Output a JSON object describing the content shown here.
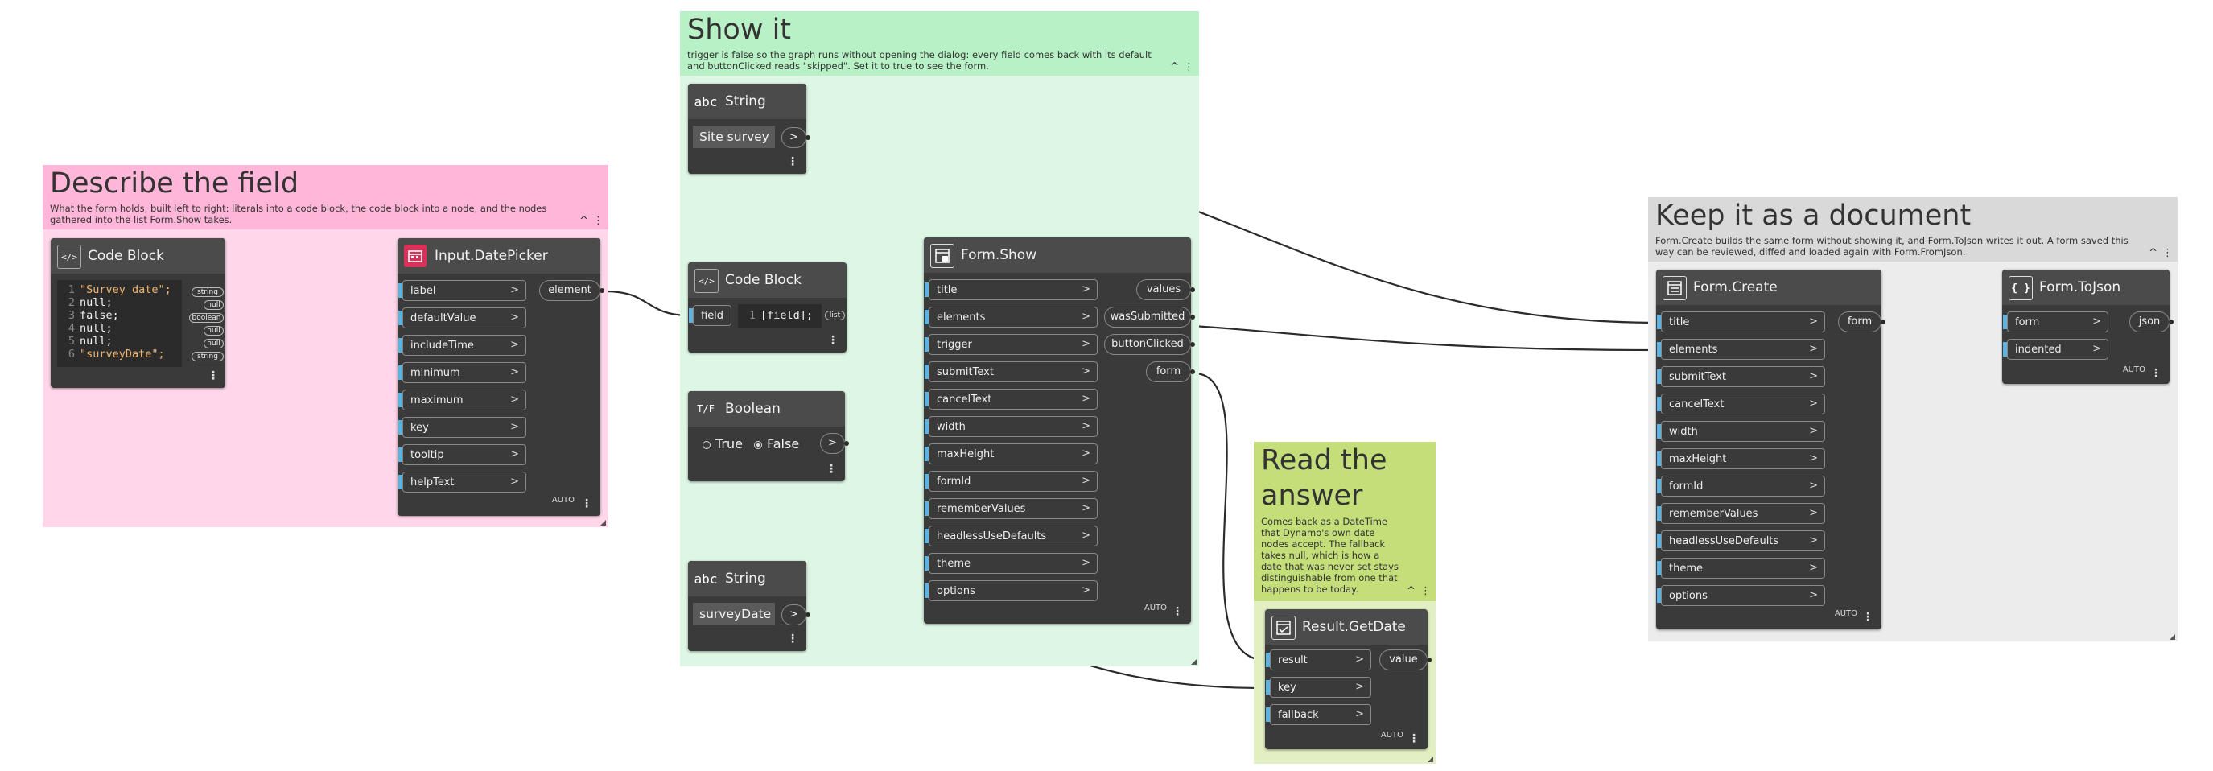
{
  "groups": {
    "describe": {
      "title": "Describe the field",
      "desc": "What the form holds, built left to right: literals into a code block, the code block into a node, and the nodes gathered into the list Form.Show takes.",
      "color": "#ffd6ea",
      "head_color": "#ffb6d8"
    },
    "show": {
      "title": "Show it",
      "desc": "trigger is false so the graph runs without opening the dialog: every field comes back with its default and buttonClicked reads \"skipped\". Set it to true to see the form.",
      "color": "#ddf7e4",
      "head_color": "#b8f1c6"
    },
    "read": {
      "title": "Read the answer",
      "desc": "Comes back as a DateTime that Dynamo's own date nodes accept. The fallback takes null, which is how a date that was never set stays distinguishable from one that happens to be today.",
      "color": "#e2efc2",
      "head_color": "#c4df7a"
    },
    "keep": {
      "title": "Keep it as a document",
      "desc": "Form.Create builds the same form without showing it, and Form.ToJson writes it out. A form saved this way can be reviewed, diffed and loaded again with Form.FromJson.",
      "color": "#ececec",
      "head_color": "#d9d9d9"
    }
  },
  "nodes": {
    "code_block_1": {
      "title": "Code Block",
      "lines": [
        {
          "n": "1",
          "text": "\"Survey date\";",
          "kind": "str",
          "type": "string"
        },
        {
          "n": "2",
          "text": "null;",
          "kind": "kw",
          "type": "null"
        },
        {
          "n": "3",
          "text": "false;",
          "kind": "kw",
          "type": "boolean"
        },
        {
          "n": "4",
          "text": "null;",
          "kind": "kw",
          "type": "null"
        },
        {
          "n": "5",
          "text": "null;",
          "kind": "kw",
          "type": "null"
        },
        {
          "n": "6",
          "text": "\"surveyDate\";",
          "kind": "str",
          "type": "string"
        }
      ]
    },
    "date_picker": {
      "title": "Input.DatePicker",
      "inputs": [
        "label",
        "defaultValue",
        "includeTime",
        "minimum",
        "maximum",
        "key",
        "tooltip",
        "helpText"
      ],
      "output": "element",
      "auto": "AUTO"
    },
    "string_1": {
      "title": "String",
      "value": "Site survey"
    },
    "code_block_2": {
      "title": "Code Block",
      "input": "field",
      "line_no": "1",
      "code": "[field];",
      "output": "list"
    },
    "boolean": {
      "title": "Boolean",
      "true_label": "True",
      "false_label": "False",
      "selected": "False"
    },
    "string_2": {
      "title": "String",
      "value": "surveyDate"
    },
    "form_show": {
      "title": "Form.Show",
      "inputs": [
        "title",
        "elements",
        "trigger",
        "submitText",
        "cancelText",
        "width",
        "maxHeight",
        "formId",
        "rememberValues",
        "headlessUseDefaults",
        "theme",
        "options"
      ],
      "outputs": [
        "values",
        "wasSubmitted",
        "buttonClicked",
        "form"
      ],
      "auto": "AUTO"
    },
    "result_get_date": {
      "title": "Result.GetDate",
      "inputs": [
        "result",
        "key",
        "fallback"
      ],
      "output": "value",
      "auto": "AUTO"
    },
    "form_create": {
      "title": "Form.Create",
      "inputs": [
        "title",
        "elements",
        "submitText",
        "cancelText",
        "width",
        "maxHeight",
        "formId",
        "rememberValues",
        "headlessUseDefaults",
        "theme",
        "options"
      ],
      "output": "form",
      "auto": "AUTO"
    },
    "form_to_json": {
      "title": "Form.ToJson",
      "inputs": [
        "form",
        "indented"
      ],
      "output": "json",
      "auto": "AUTO"
    }
  },
  "icons": {
    "code_block": "code-block-icon",
    "datepicker": "calendar-icon",
    "string": "abc-string-icon",
    "boolean": "true-false-icon",
    "form": "form-icon",
    "json": "json-braces-icon"
  },
  "glyphs": {
    "arrow": ">",
    "collapse": "^",
    "menu": "⋮",
    "code": "</>",
    "abc": "abc",
    "tf": "T/F",
    "braces": "{ }"
  },
  "colors": {
    "port_accent": "#5cb3e0",
    "wire": "#2b2b2b",
    "node_body": "#3a3a3a",
    "node_header": "#4b4b4b"
  }
}
